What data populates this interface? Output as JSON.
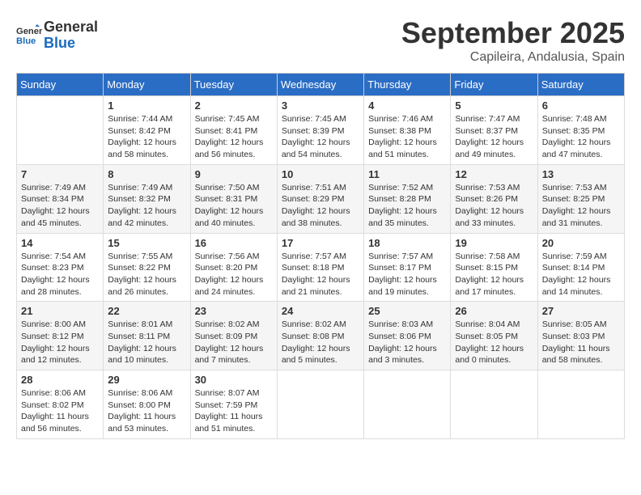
{
  "header": {
    "logo_line1": "General",
    "logo_line2": "Blue",
    "month": "September 2025",
    "location": "Capileira, Andalusia, Spain"
  },
  "days_of_week": [
    "Sunday",
    "Monday",
    "Tuesday",
    "Wednesday",
    "Thursday",
    "Friday",
    "Saturday"
  ],
  "weeks": [
    [
      {
        "num": "",
        "info": ""
      },
      {
        "num": "1",
        "info": "Sunrise: 7:44 AM\nSunset: 8:42 PM\nDaylight: 12 hours\nand 58 minutes."
      },
      {
        "num": "2",
        "info": "Sunrise: 7:45 AM\nSunset: 8:41 PM\nDaylight: 12 hours\nand 56 minutes."
      },
      {
        "num": "3",
        "info": "Sunrise: 7:45 AM\nSunset: 8:39 PM\nDaylight: 12 hours\nand 54 minutes."
      },
      {
        "num": "4",
        "info": "Sunrise: 7:46 AM\nSunset: 8:38 PM\nDaylight: 12 hours\nand 51 minutes."
      },
      {
        "num": "5",
        "info": "Sunrise: 7:47 AM\nSunset: 8:37 PM\nDaylight: 12 hours\nand 49 minutes."
      },
      {
        "num": "6",
        "info": "Sunrise: 7:48 AM\nSunset: 8:35 PM\nDaylight: 12 hours\nand 47 minutes."
      }
    ],
    [
      {
        "num": "7",
        "info": "Sunrise: 7:49 AM\nSunset: 8:34 PM\nDaylight: 12 hours\nand 45 minutes."
      },
      {
        "num": "8",
        "info": "Sunrise: 7:49 AM\nSunset: 8:32 PM\nDaylight: 12 hours\nand 42 minutes."
      },
      {
        "num": "9",
        "info": "Sunrise: 7:50 AM\nSunset: 8:31 PM\nDaylight: 12 hours\nand 40 minutes."
      },
      {
        "num": "10",
        "info": "Sunrise: 7:51 AM\nSunset: 8:29 PM\nDaylight: 12 hours\nand 38 minutes."
      },
      {
        "num": "11",
        "info": "Sunrise: 7:52 AM\nSunset: 8:28 PM\nDaylight: 12 hours\nand 35 minutes."
      },
      {
        "num": "12",
        "info": "Sunrise: 7:53 AM\nSunset: 8:26 PM\nDaylight: 12 hours\nand 33 minutes."
      },
      {
        "num": "13",
        "info": "Sunrise: 7:53 AM\nSunset: 8:25 PM\nDaylight: 12 hours\nand 31 minutes."
      }
    ],
    [
      {
        "num": "14",
        "info": "Sunrise: 7:54 AM\nSunset: 8:23 PM\nDaylight: 12 hours\nand 28 minutes."
      },
      {
        "num": "15",
        "info": "Sunrise: 7:55 AM\nSunset: 8:22 PM\nDaylight: 12 hours\nand 26 minutes."
      },
      {
        "num": "16",
        "info": "Sunrise: 7:56 AM\nSunset: 8:20 PM\nDaylight: 12 hours\nand 24 minutes."
      },
      {
        "num": "17",
        "info": "Sunrise: 7:57 AM\nSunset: 8:18 PM\nDaylight: 12 hours\nand 21 minutes."
      },
      {
        "num": "18",
        "info": "Sunrise: 7:57 AM\nSunset: 8:17 PM\nDaylight: 12 hours\nand 19 minutes."
      },
      {
        "num": "19",
        "info": "Sunrise: 7:58 AM\nSunset: 8:15 PM\nDaylight: 12 hours\nand 17 minutes."
      },
      {
        "num": "20",
        "info": "Sunrise: 7:59 AM\nSunset: 8:14 PM\nDaylight: 12 hours\nand 14 minutes."
      }
    ],
    [
      {
        "num": "21",
        "info": "Sunrise: 8:00 AM\nSunset: 8:12 PM\nDaylight: 12 hours\nand 12 minutes."
      },
      {
        "num": "22",
        "info": "Sunrise: 8:01 AM\nSunset: 8:11 PM\nDaylight: 12 hours\nand 10 minutes."
      },
      {
        "num": "23",
        "info": "Sunrise: 8:02 AM\nSunset: 8:09 PM\nDaylight: 12 hours\nand 7 minutes."
      },
      {
        "num": "24",
        "info": "Sunrise: 8:02 AM\nSunset: 8:08 PM\nDaylight: 12 hours\nand 5 minutes."
      },
      {
        "num": "25",
        "info": "Sunrise: 8:03 AM\nSunset: 8:06 PM\nDaylight: 12 hours\nand 3 minutes."
      },
      {
        "num": "26",
        "info": "Sunrise: 8:04 AM\nSunset: 8:05 PM\nDaylight: 12 hours\nand 0 minutes."
      },
      {
        "num": "27",
        "info": "Sunrise: 8:05 AM\nSunset: 8:03 PM\nDaylight: 11 hours\nand 58 minutes."
      }
    ],
    [
      {
        "num": "28",
        "info": "Sunrise: 8:06 AM\nSunset: 8:02 PM\nDaylight: 11 hours\nand 56 minutes."
      },
      {
        "num": "29",
        "info": "Sunrise: 8:06 AM\nSunset: 8:00 PM\nDaylight: 11 hours\nand 53 minutes."
      },
      {
        "num": "30",
        "info": "Sunrise: 8:07 AM\nSunset: 7:59 PM\nDaylight: 11 hours\nand 51 minutes."
      },
      {
        "num": "",
        "info": ""
      },
      {
        "num": "",
        "info": ""
      },
      {
        "num": "",
        "info": ""
      },
      {
        "num": "",
        "info": ""
      }
    ]
  ]
}
